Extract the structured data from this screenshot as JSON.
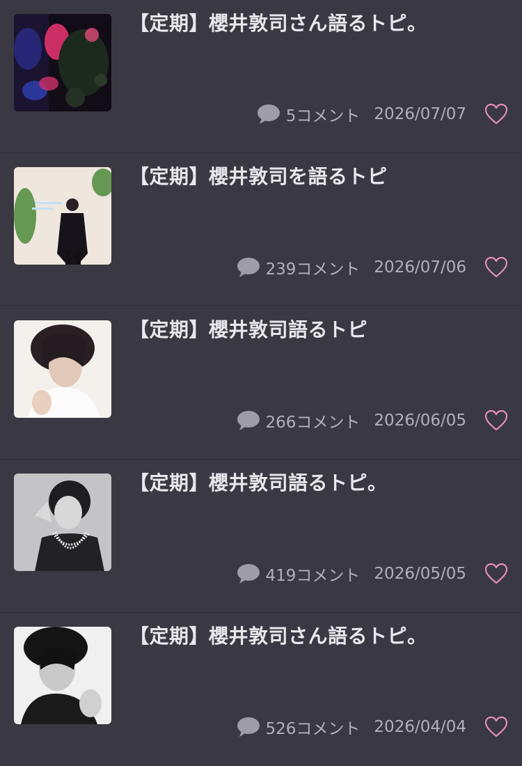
{
  "topics": [
    {
      "title": "【定期】櫻井敦司さん語るトピ。",
      "comments_text": "5コメント",
      "date": "2026/07/07",
      "thumbnail": "artistic-red-blue-photo"
    },
    {
      "title": "【定期】櫻井敦司を語るトピ",
      "comments_text": "239コメント",
      "date": "2026/07/06",
      "thumbnail": "man-in-black-with-plants"
    },
    {
      "title": "【定期】櫻井敦司語るトピ",
      "comments_text": "266コメント",
      "date": "2026/06/05",
      "thumbnail": "portrait-white-shirt"
    },
    {
      "title": "【定期】櫻井敦司語るトピ。",
      "comments_text": "419コメント",
      "date": "2026/05/05",
      "thumbnail": "monochrome-portrait-pearls"
    },
    {
      "title": "【定期】櫻井敦司さん語るトピ。",
      "comments_text": "526コメント",
      "date": "2026/04/04",
      "thumbnail": "monochrome-portrait-curly-hair"
    }
  ],
  "colors": {
    "background": "#3a3842",
    "title": "#e8e7ec",
    "meta_text": "#b1afb9",
    "comment_icon": "#9e9ca6",
    "heart_accent": "#e48fb6"
  },
  "icons": {
    "comment": "speech-bubble-icon",
    "favorite": "heart-outline-icon"
  }
}
